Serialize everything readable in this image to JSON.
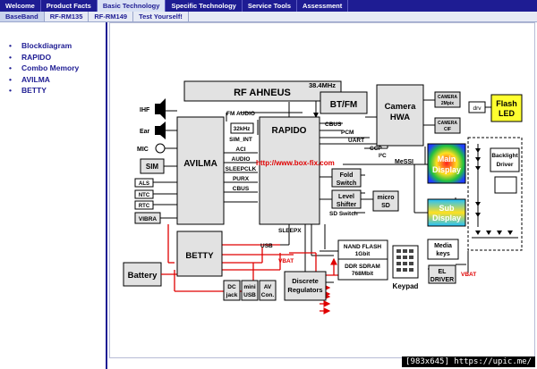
{
  "nav": {
    "tabs": [
      "Welcome",
      "Product Facts",
      "Basic Technology",
      "Specific Technology",
      "Service Tools",
      "Assessment"
    ],
    "active_tab": 2,
    "subtabs": [
      "BaseBand",
      "RF-RM135",
      "RF-RM149",
      "Test Yourself!"
    ],
    "active_subtab": 0
  },
  "sidebar": {
    "bullet": "•",
    "items": [
      "Blockdiagram",
      "RAPIDO",
      "Combo Memory",
      "AVILMA",
      "BETTY"
    ]
  },
  "diagram": {
    "blocks": {
      "rf_ahneus": "RF AHNEUS",
      "bt_fm": "BT/FM",
      "camera_hwa": [
        "Camera",
        "HWA"
      ],
      "camera_2mpix": [
        "CAMERA",
        "2Mpix"
      ],
      "camera_cif": [
        "CAMERA",
        "CIF"
      ],
      "drv": "drv",
      "flash_led": [
        "Flash",
        "LED"
      ],
      "avilma": "AVILMA",
      "rapido": "RAPIDO",
      "sim": "SIM",
      "main_display": [
        "Main",
        "Display"
      ],
      "sub_display": [
        "Sub",
        "Display"
      ],
      "backlight_driver": [
        "Backlight",
        "Driver"
      ],
      "fold_switch": [
        "Fold",
        "Switch"
      ],
      "level_shifter": [
        "Level",
        "Shifter"
      ],
      "micro_sd": [
        "micro",
        "SD"
      ],
      "battery": "Battery",
      "betty": "BETTY",
      "dc_jack": [
        "DC",
        "jack"
      ],
      "mini_usb": [
        "mini",
        "USB"
      ],
      "av_con": [
        "AV",
        "Con."
      ],
      "discrete_regulators": [
        "Discrete",
        "Regulators"
      ],
      "nand_flash": [
        "NAND FLASH",
        "1Gbit"
      ],
      "ddr_sdram": [
        "DDR SDRAM",
        "768Mbit"
      ],
      "media_keys": [
        "Media",
        "keys"
      ],
      "keypad": "Keypad",
      "el_driver": [
        "EL",
        "DRIVER"
      ],
      "vibra": "VIBRA"
    },
    "signals": {
      "freq": "38.4MHz",
      "fm_audio": "FM AUDIO",
      "clk32": "32kHz",
      "sim_int": "SIM_INT",
      "aci": "ACI",
      "audio": "AUDIO",
      "sleepclk": "SLEEPCLK",
      "purx": "PURX",
      "cbus_l": "CBUS",
      "cbus_r": "CBUS",
      "pcm": "PCM",
      "uart": "UART",
      "ccp": "CCP",
      "i2c": "I²C",
      "messi": "MeSSI",
      "sd_switch": "SD Switch",
      "sleepx": "SLEEPX",
      "usb": "USB",
      "vbat1": "VBAT",
      "vbat2": "VBAT",
      "url": "http://www.box-fix.com"
    },
    "peripherals": {
      "ihf": "IHF",
      "ear": "Ear",
      "mic": "MIC",
      "als": "ALS",
      "ntc": "NTC",
      "rtc": "RTC"
    }
  },
  "watermark": "[983x645] https://upic.me/"
}
